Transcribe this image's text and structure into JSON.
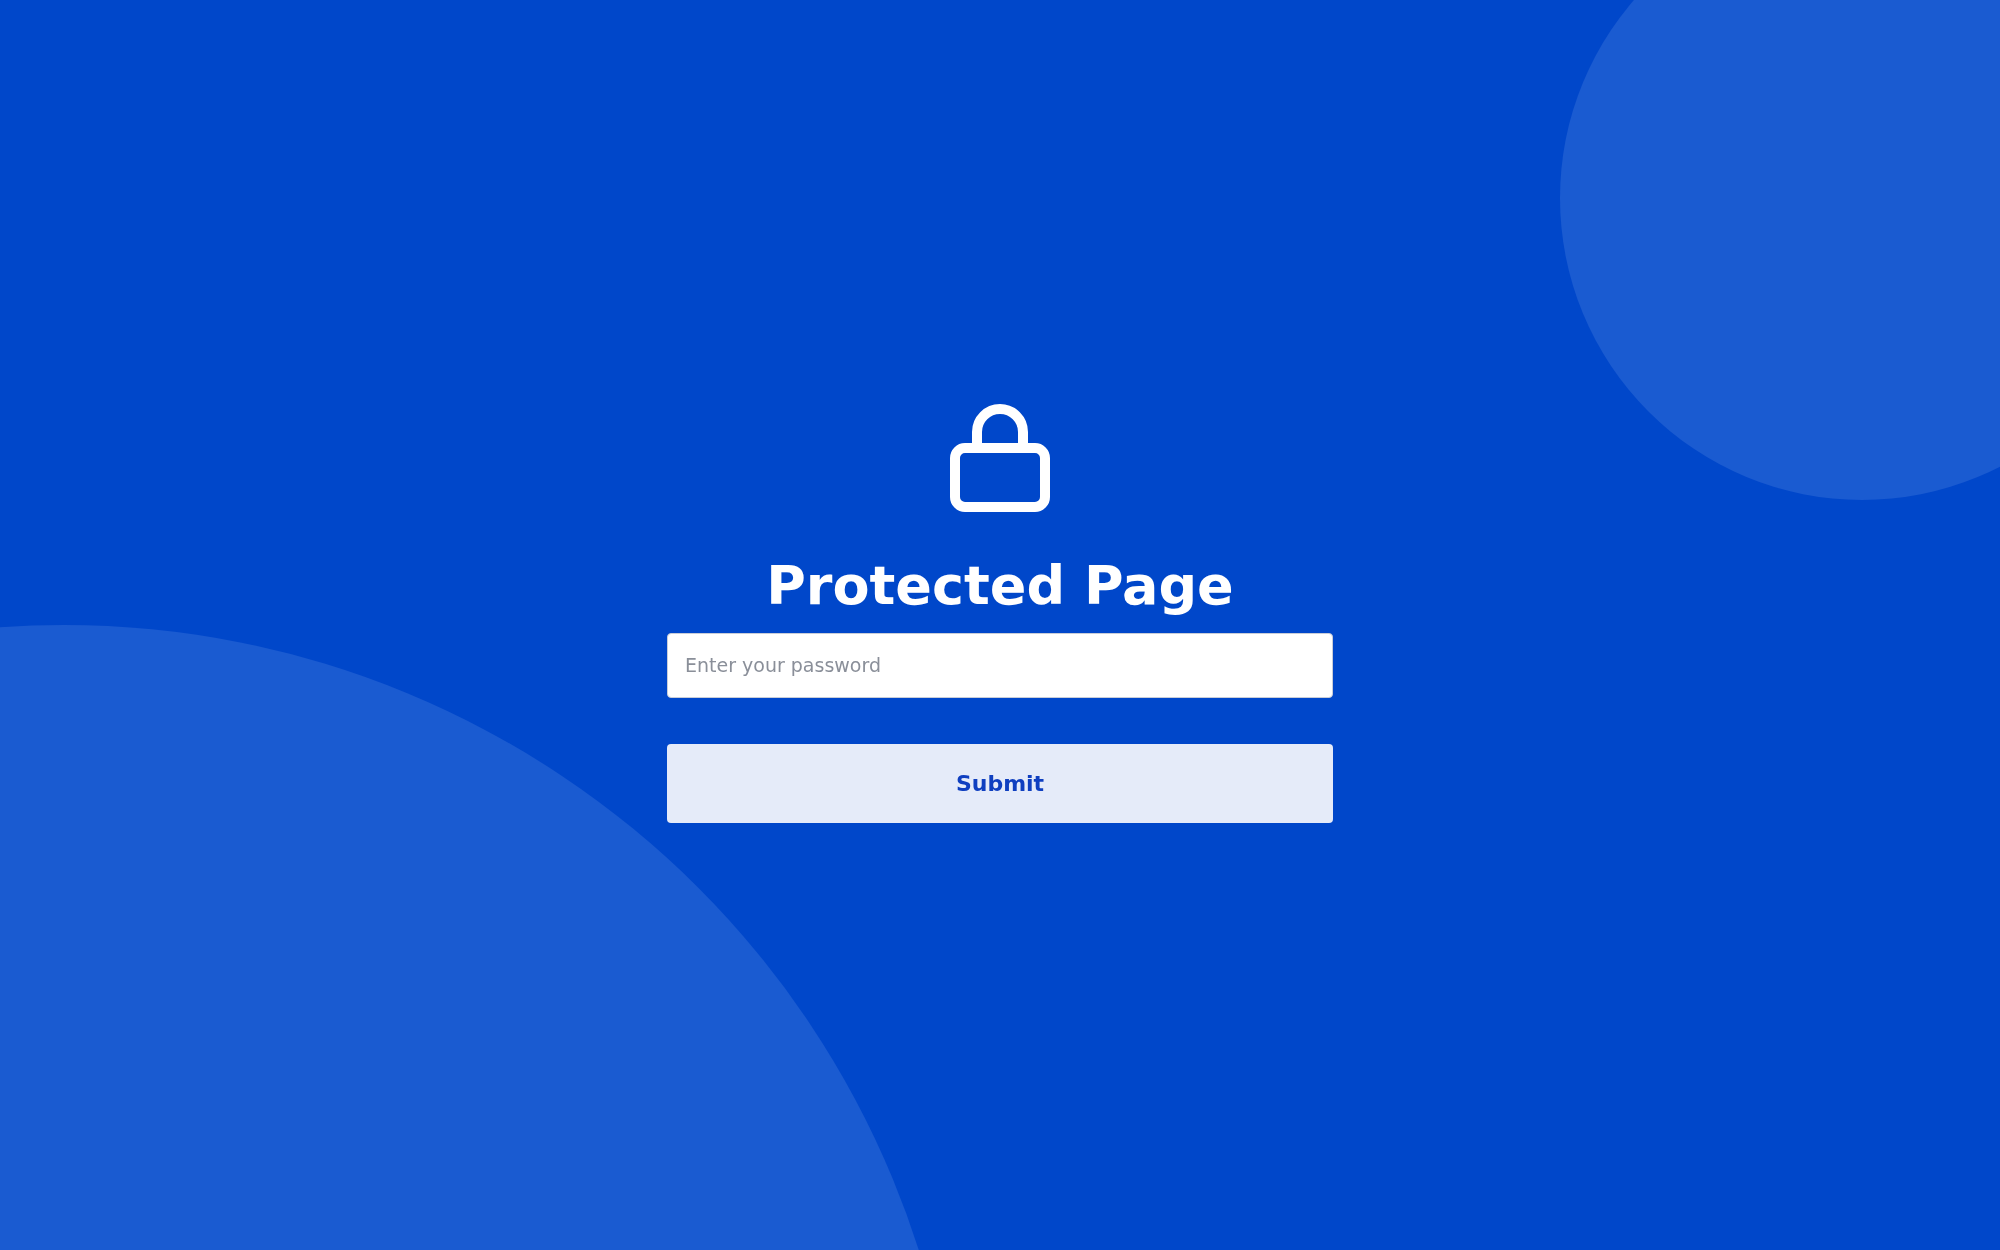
{
  "title": "Protected Page",
  "password_field": {
    "placeholder": "Enter your password"
  },
  "submit_button": {
    "label": "Submit"
  }
}
